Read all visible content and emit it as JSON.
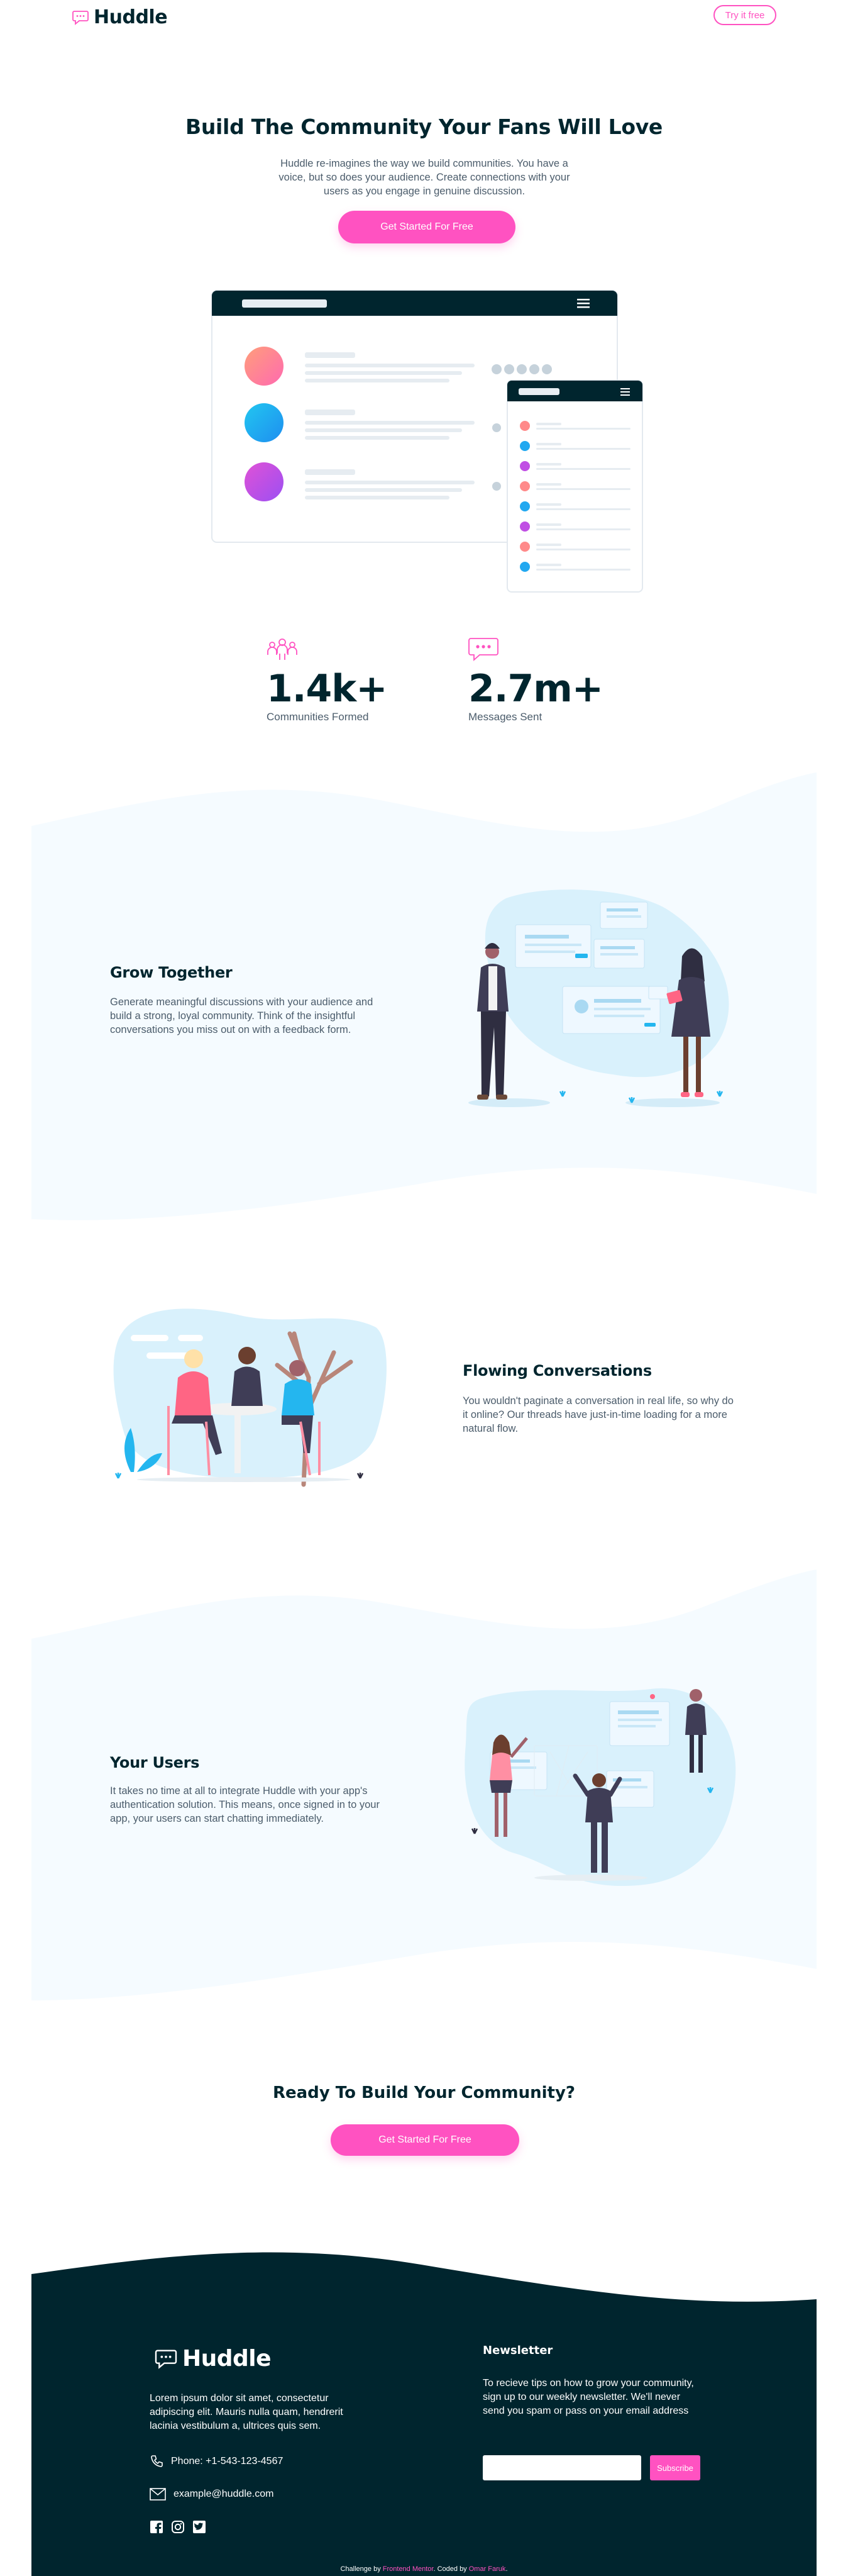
{
  "header": {
    "logo_text": "Huddle",
    "try_label": "Try it free"
  },
  "hero": {
    "title": "Build The Community Your Fans Will Love",
    "description": "Huddle re-imagines the way we build communities. You have a voice, but so does your audience. Create connections with your users as you engage in genuine discussion.",
    "cta_label": "Get Started For Free"
  },
  "stats": [
    {
      "value": "1.4k+",
      "label": "Communities Formed",
      "icon": "communities-icon"
    },
    {
      "value": "2.7m+",
      "label": "Messages Sent",
      "icon": "messages-icon"
    }
  ],
  "features": [
    {
      "title": "Grow Together",
      "description": "Generate meaningful discussions with your audience and build a strong, loyal community. Think of the insightful conversations you miss out on with a feedback form."
    },
    {
      "title": "Flowing Conversations",
      "description": "You wouldn't paginate a conversation in real life, so why do it online? Our threads have just-in-time loading for a more natural flow."
    },
    {
      "title": "Your Users",
      "description": "It takes no time at all to integrate Huddle with your app's authentication solution. This means, once signed in to your app, your users can start chatting immediately."
    }
  ],
  "cta": {
    "title": "Ready To Build Your Community?",
    "button_label": "Get Started For Free"
  },
  "footer": {
    "logo_text": "Huddle",
    "about": "Lorem ipsum dolor sit amet, consectetur adipiscing elit. Mauris nulla quam, hendrerit lacinia vestibulum a, ultrices quis sem.",
    "phone": "Phone: +1-543-123-4567",
    "email": "example@huddle.com",
    "social_icons": [
      "facebook-icon",
      "instagram-icon",
      "twitter-icon"
    ],
    "newsletter_title": "Newsletter",
    "newsletter_desc": "To recieve tips on how to grow your community, sign up to our weekly newsletter. We'll never send you spam or pass on your email address",
    "newsletter_placeholder": "",
    "subscribe_label": "Subscribe",
    "attribution_prefix": "Challenge by ",
    "attribution_fm": "Frontend Mentor",
    "attribution_mid": ". Coded by ",
    "attribution_author": "Omar Faruk",
    "attribution_suffix": "."
  },
  "colors": {
    "pink": "#ff52c1",
    "dark": "#00252e",
    "light_bg": "#f5fbff",
    "text_gray": "#4b5c6b"
  }
}
